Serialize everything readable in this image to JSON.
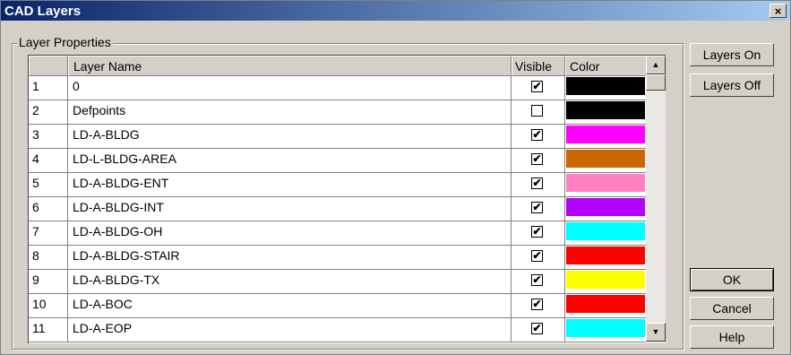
{
  "window": {
    "title": "CAD Layers",
    "close_label": "×"
  },
  "group": {
    "label": "Layer Properties"
  },
  "table": {
    "headers": {
      "num": "",
      "name": "Layer Name",
      "visible": "Visible",
      "color": "Color"
    },
    "rows": [
      {
        "num": "1",
        "name": "0",
        "visible": true,
        "color": "#000000"
      },
      {
        "num": "2",
        "name": "Defpoints",
        "visible": false,
        "color": "#000000"
      },
      {
        "num": "3",
        "name": "LD-A-BLDG",
        "visible": true,
        "color": "#ff00ff"
      },
      {
        "num": "4",
        "name": "LD-L-BLDG-AREA",
        "visible": true,
        "color": "#cc6600"
      },
      {
        "num": "5",
        "name": "LD-A-BLDG-ENT",
        "visible": true,
        "color": "#ff80c0"
      },
      {
        "num": "6",
        "name": "LD-A-BLDG-INT",
        "visible": true,
        "color": "#b000ff"
      },
      {
        "num": "7",
        "name": "LD-A-BLDG-OH",
        "visible": true,
        "color": "#00ffff"
      },
      {
        "num": "8",
        "name": "LD-A-BLDG-STAIR",
        "visible": true,
        "color": "#ff0000"
      },
      {
        "num": "9",
        "name": "LD-A-BLDG-TX",
        "visible": true,
        "color": "#ffff00"
      },
      {
        "num": "10",
        "name": "LD-A-BOC",
        "visible": true,
        "color": "#ff0000"
      },
      {
        "num": "11",
        "name": "LD-A-EOP",
        "visible": true,
        "color": "#00ffff"
      }
    ]
  },
  "buttons": {
    "layers_on": "Layers On",
    "layers_off": "Layers Off",
    "ok": "OK",
    "cancel": "Cancel",
    "help": "Help"
  },
  "scroll": {
    "up_icon": "▲",
    "down_icon": "▼"
  },
  "check_glyph": "✔"
}
